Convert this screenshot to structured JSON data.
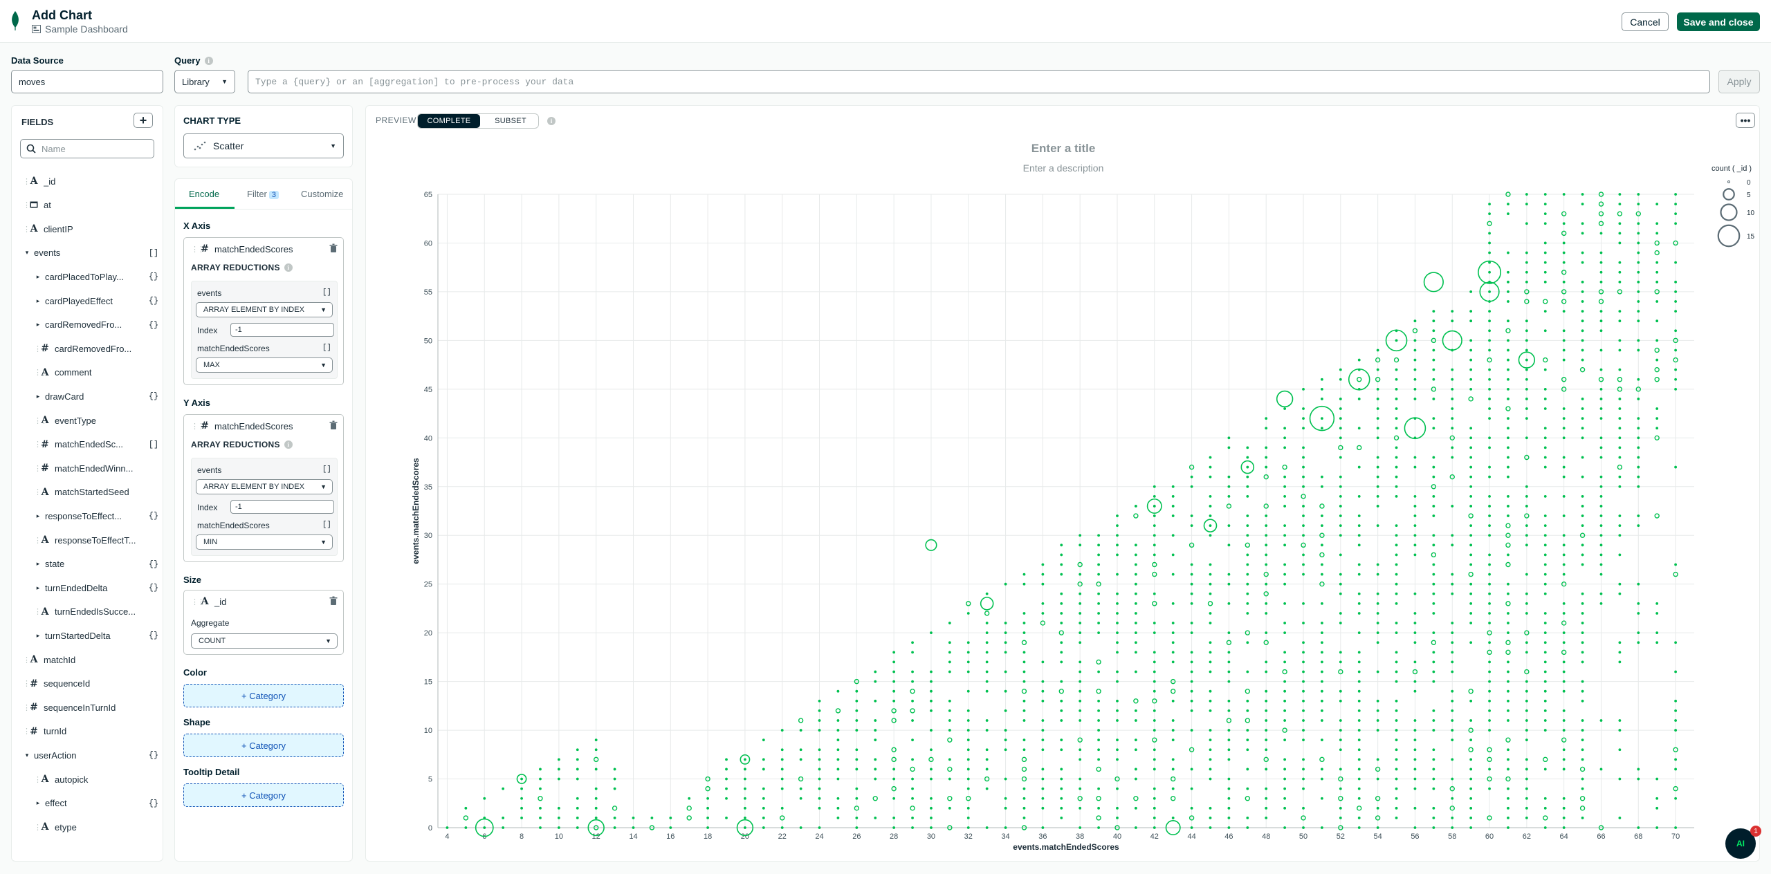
{
  "header": {
    "title": "Add Chart",
    "dashboard": "Sample Dashboard",
    "cancel_label": "Cancel",
    "save_label": "Save and close"
  },
  "datasource": {
    "label": "Data Source",
    "value": "moves"
  },
  "query": {
    "label": "Query",
    "library_label": "Library",
    "placeholder": "Type a {query} or an [aggregation] to pre-process your data",
    "apply_label": "Apply"
  },
  "fields": {
    "title": "FIELDS",
    "add_label": "+",
    "search_placeholder": "Name",
    "items": [
      {
        "name": "_id",
        "type": "A",
        "level": 0,
        "caret": "",
        "suffix": ""
      },
      {
        "name": "at",
        "type": "date",
        "level": 0,
        "caret": "",
        "suffix": ""
      },
      {
        "name": "clientIP",
        "type": "A",
        "level": 0,
        "caret": "",
        "suffix": ""
      },
      {
        "name": "events",
        "type": "",
        "level": 0,
        "caret": "▾",
        "suffix": "[]"
      },
      {
        "name": "cardPlacedToPlay...",
        "type": "",
        "level": 1,
        "caret": "▸",
        "suffix": "{}"
      },
      {
        "name": "cardPlayedEffect",
        "type": "",
        "level": 1,
        "caret": "▸",
        "suffix": "{}"
      },
      {
        "name": "cardRemovedFro...",
        "type": "",
        "level": 1,
        "caret": "▸",
        "suffix": "{}"
      },
      {
        "name": "cardRemovedFro...",
        "type": "#",
        "level": 1,
        "caret": "",
        "suffix": ""
      },
      {
        "name": "comment",
        "type": "A",
        "level": 1,
        "caret": "",
        "suffix": ""
      },
      {
        "name": "drawCard",
        "type": "",
        "level": 1,
        "caret": "▸",
        "suffix": "{}"
      },
      {
        "name": "eventType",
        "type": "A",
        "level": 1,
        "caret": "",
        "suffix": ""
      },
      {
        "name": "matchEndedSc...",
        "type": "#",
        "level": 1,
        "caret": "",
        "suffix": "[]"
      },
      {
        "name": "matchEndedWinn...",
        "type": "#",
        "level": 1,
        "caret": "",
        "suffix": ""
      },
      {
        "name": "matchStartedSeed",
        "type": "A",
        "level": 1,
        "caret": "",
        "suffix": ""
      },
      {
        "name": "responseToEffect...",
        "type": "",
        "level": 1,
        "caret": "▸",
        "suffix": "{}"
      },
      {
        "name": "responseToEffectT...",
        "type": "A",
        "level": 1,
        "caret": "",
        "suffix": ""
      },
      {
        "name": "state",
        "type": "",
        "level": 1,
        "caret": "▸",
        "suffix": "{}"
      },
      {
        "name": "turnEndedDelta",
        "type": "",
        "level": 1,
        "caret": "▸",
        "suffix": "{}"
      },
      {
        "name": "turnEndedIsSucce...",
        "type": "A",
        "level": 1,
        "caret": "",
        "suffix": ""
      },
      {
        "name": "turnStartedDelta",
        "type": "",
        "level": 1,
        "caret": "▸",
        "suffix": "{}"
      },
      {
        "name": "matchId",
        "type": "A",
        "level": 0,
        "caret": "",
        "suffix": ""
      },
      {
        "name": "sequenceId",
        "type": "#",
        "level": 0,
        "caret": "",
        "suffix": ""
      },
      {
        "name": "sequenceInTurnId",
        "type": "#",
        "level": 0,
        "caret": "",
        "suffix": ""
      },
      {
        "name": "turnId",
        "type": "#",
        "level": 0,
        "caret": "",
        "suffix": ""
      },
      {
        "name": "userAction",
        "type": "",
        "level": 0,
        "caret": "▾",
        "suffix": "{}"
      },
      {
        "name": "autopick",
        "type": "A",
        "level": 1,
        "caret": "",
        "suffix": ""
      },
      {
        "name": "effect",
        "type": "",
        "level": 1,
        "caret": "▸",
        "suffix": "{}"
      },
      {
        "name": "etype",
        "type": "A",
        "level": 1,
        "caret": "",
        "suffix": ""
      }
    ]
  },
  "chart_type": {
    "label": "CHART TYPE",
    "value": "Scatter"
  },
  "encode": {
    "tabs": [
      {
        "label": "Encode"
      },
      {
        "label": "Filter",
        "badge": "3"
      },
      {
        "label": "Customize"
      }
    ],
    "x_axis": {
      "title": "X Axis",
      "field": "matchEndedScores",
      "reductions_label": "ARRAY REDUCTIONS",
      "r1_field": "events",
      "r1_suffix": "[]",
      "r1_method": "ARRAY ELEMENT BY INDEX",
      "index_label": "Index",
      "index_value": "-1",
      "r2_field": "matchEndedScores",
      "r2_suffix": "[]",
      "r2_method": "MAX"
    },
    "y_axis": {
      "title": "Y Axis",
      "field": "matchEndedScores",
      "reductions_label": "ARRAY REDUCTIONS",
      "r1_field": "events",
      "r1_suffix": "[]",
      "r1_method": "ARRAY ELEMENT BY INDEX",
      "index_label": "Index",
      "index_value": "-1",
      "r2_field": "matchEndedScores",
      "r2_suffix": "[]",
      "r2_method": "MIN"
    },
    "size": {
      "title": "Size",
      "field": "_id",
      "aggregate_label": "Aggregate",
      "aggregate_value": "COUNT"
    },
    "color": {
      "title": "Color",
      "button": "+ Category"
    },
    "shape": {
      "title": "Shape",
      "button": "+ Category"
    },
    "tooltip": {
      "title": "Tooltip Detail",
      "button": "+ Category"
    }
  },
  "preview": {
    "label": "PREVIEW",
    "complete_label": "COMPLETE",
    "subset_label": "SUBSET",
    "more_label": "•••",
    "title_placeholder": "Enter a title",
    "desc_placeholder": "Enter a description"
  },
  "chat": {
    "label": "AI",
    "badge": "1"
  },
  "colors": {
    "accent": "#00684a",
    "points": "#00c050"
  },
  "chart_data": {
    "type": "scatter",
    "xlabel": "events.matchEndedScores",
    "ylabel": "events.matchEndedScores",
    "xlim": [
      3.5,
      71
    ],
    "ylim": [
      0,
      65
    ],
    "x_ticks": [
      4,
      6,
      8,
      10,
      12,
      14,
      16,
      18,
      20,
      22,
      24,
      26,
      28,
      30,
      32,
      34,
      36,
      38,
      40,
      42,
      44,
      46,
      48,
      50,
      52,
      54,
      56,
      58,
      60,
      62,
      64,
      66,
      68,
      70
    ],
    "y_ticks": [
      0,
      5,
      10,
      15,
      20,
      25,
      30,
      35,
      40,
      45,
      50,
      55,
      60,
      65
    ],
    "grid": true,
    "legend": {
      "title": "count ( _id )",
      "position": "right",
      "sizes": [
        0,
        5,
        10,
        15
      ]
    },
    "highlighted_points": [
      {
        "x": 6,
        "y": 0,
        "count": 8
      },
      {
        "x": 12,
        "y": 0,
        "count": 7
      },
      {
        "x": 20,
        "y": 0,
        "count": 7
      },
      {
        "x": 43,
        "y": 0,
        "count": 6
      },
      {
        "x": 8,
        "y": 5,
        "count": 3
      },
      {
        "x": 20,
        "y": 7,
        "count": 3
      },
      {
        "x": 30,
        "y": 29,
        "count": 4
      },
      {
        "x": 33,
        "y": 23,
        "count": 5
      },
      {
        "x": 42,
        "y": 33,
        "count": 6
      },
      {
        "x": 45,
        "y": 31,
        "count": 5
      },
      {
        "x": 47,
        "y": 37,
        "count": 5
      },
      {
        "x": 49,
        "y": 44,
        "count": 7
      },
      {
        "x": 51,
        "y": 42,
        "count": 12
      },
      {
        "x": 53,
        "y": 46,
        "count": 10
      },
      {
        "x": 55,
        "y": 50,
        "count": 10
      },
      {
        "x": 56,
        "y": 41,
        "count": 10
      },
      {
        "x": 57,
        "y": 56,
        "count": 9
      },
      {
        "x": 58,
        "y": 50,
        "count": 9
      },
      {
        "x": 60,
        "y": 57,
        "count": 11
      },
      {
        "x": 60,
        "y": 55,
        "count": 9
      },
      {
        "x": 62,
        "y": 48,
        "count": 7
      }
    ]
  }
}
